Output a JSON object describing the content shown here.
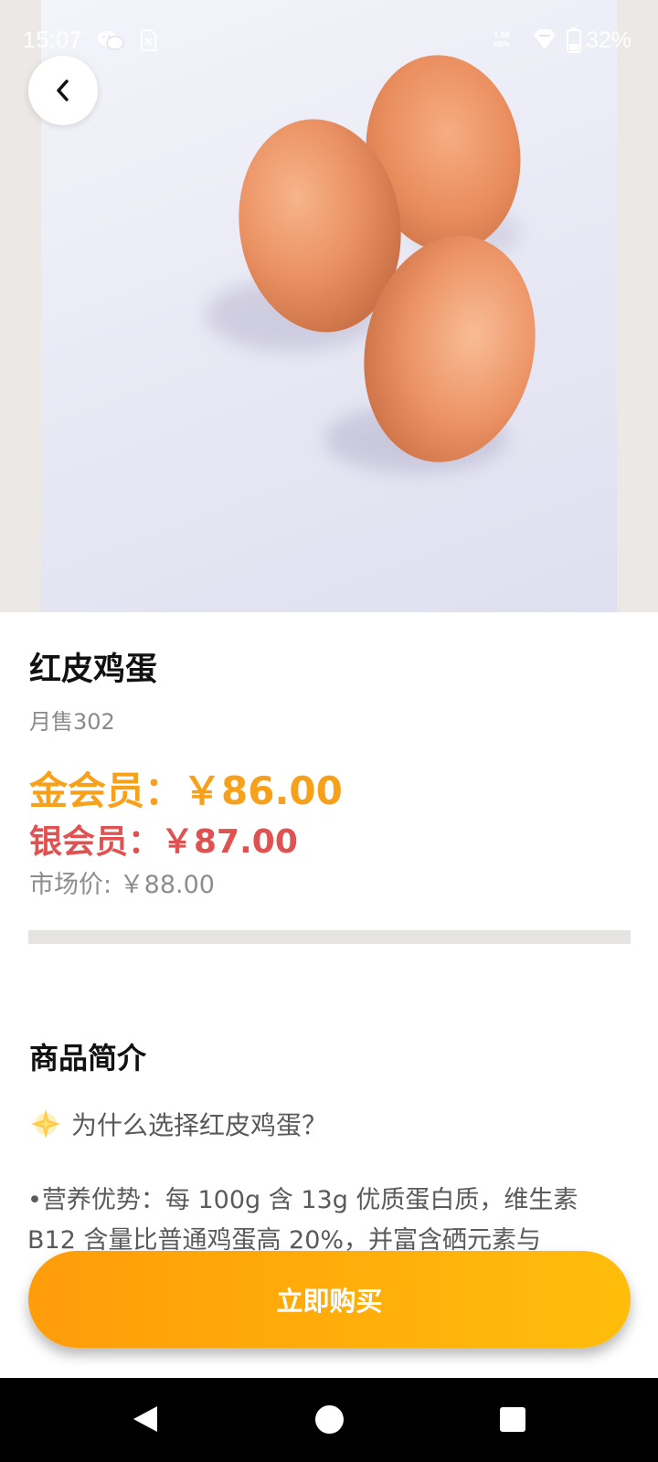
{
  "status_bar": {
    "time": "15:07",
    "network_speed_top": "1.86",
    "network_speed_bottom": "kb/s",
    "battery_percent": "32%",
    "icons": [
      "wechat-icon",
      "sim-icon",
      "signal-icon",
      "battery-icon"
    ]
  },
  "product": {
    "image_description_icon": "eggs-photo",
    "title": "红皮鸡蛋",
    "monthly_sales": "月售302",
    "gold_price": "金会员：￥86.00",
    "silver_price": "银会员：￥87.00",
    "market_price": "市场价: ￥88.00"
  },
  "description": {
    "section_title": "商品简介",
    "heading": "为什么选择红皮鸡蛋？",
    "heading_icon": "sparkle-star-icon",
    "body": "•营养优势：每 100g 含 13g 优质蛋白质，维生素 B12 含量比普通鸡蛋高 20%，并富含硒元素与"
  },
  "actions": {
    "buy_label": "立即购买"
  },
  "colors": {
    "gold": "#f7a01a",
    "silver": "#e05252",
    "button_start": "#ff9c0a",
    "button_end": "#ffbd0b"
  }
}
